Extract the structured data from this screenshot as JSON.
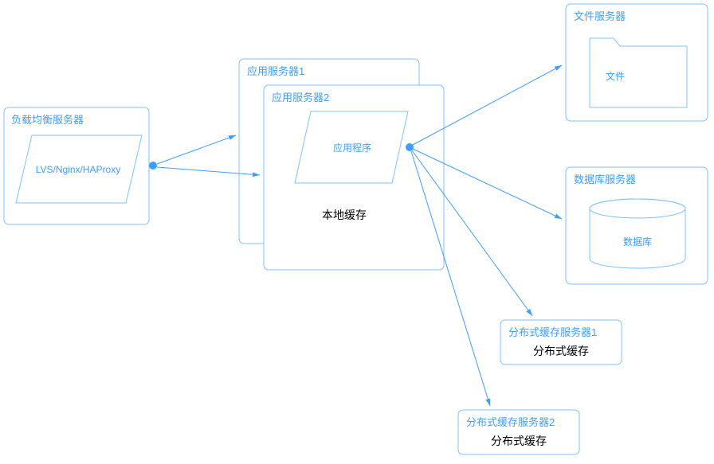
{
  "diagram": {
    "lb": {
      "title": "负载均衡服务器",
      "inner": "LVS/Nginx/HAProxy"
    },
    "app1": {
      "title": "应用服务器1"
    },
    "app2": {
      "title": "应用服务器2",
      "inner": "应用程序",
      "cache_label": "本地缓存"
    },
    "fileserver": {
      "title": "文件服务器",
      "inner": "文件"
    },
    "dbserver": {
      "title": "数据库服务器",
      "inner": "数据库"
    },
    "dcache1": {
      "title": "分布式缓存服务器1",
      "label": "分布式缓存"
    },
    "dcache2": {
      "title": "分布式缓存服务器2",
      "label": "分布式缓存"
    }
  }
}
